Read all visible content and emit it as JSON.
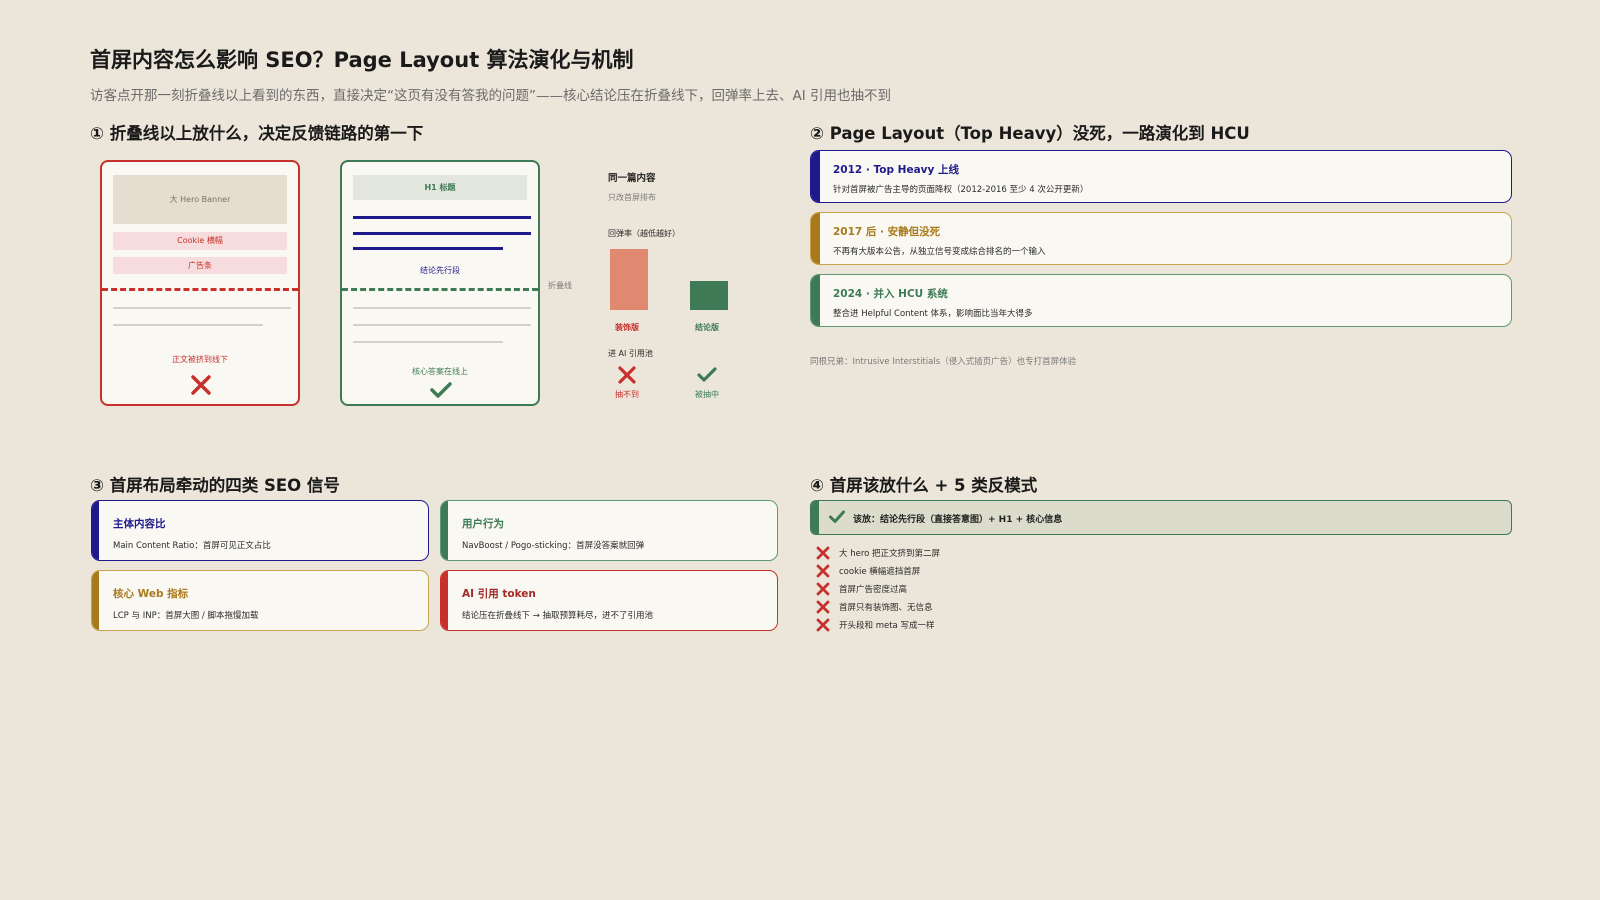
{
  "header": {
    "title": "首屏内容怎么影响 SEO？Page Layout 算法演化与机制",
    "subtitle": "访客点开那一刻折叠线以上看到的东西，直接决定“这页有没有答我的问题”——核心结论压在折叠线下，回弹率上去、AI 引用也抽不到"
  },
  "section1": {
    "title": "① 折叠线以上放什么，决定反馈链路的第一下",
    "bad_mock": {
      "hero": "大 Hero Banner",
      "cookie": "Cookie 横幅",
      "ad": "广告条",
      "caption": "正文被挤到线下"
    },
    "good_mock": {
      "h1": "H1 标题",
      "conclusion": "结论先行段",
      "caption": "核心答案在线上"
    },
    "fold_label": "折叠线",
    "compare": {
      "title": "同一篇内容",
      "subtitle": "只改首屏排布",
      "bounce_label": "回弹率（越低越好）",
      "decor_label": "装饰版",
      "concl_label": "结论版",
      "ai_label": "进 AI 引用池",
      "decor_ai": "抽不到",
      "concl_ai": "被抽中"
    }
  },
  "section2": {
    "title": "② Page Layout（Top Heavy）没死，一路演化到 HCU",
    "cards": [
      {
        "head": "2012 · Top Heavy 上线",
        "desc": "针对首屏被广告主导的页面降权（2012-2016 至少 4 次公开更新）",
        "color": "#1f1a8c"
      },
      {
        "head": "2017 后 · 安静但没死",
        "desc": "不再有大版本公告，从独立信号变成综合排名的一个输入",
        "color": "#a87a1e"
      },
      {
        "head": "2024 · 并入 HCU 系统",
        "desc": "整合进 Helpful Content 体系，影响面比当年大得多",
        "color": "#3d7a55"
      }
    ],
    "note": "同根兄弟：Intrusive Interstitials（侵入式插页广告）也专打首屏体验"
  },
  "section3": {
    "title": "③ 首屏布局牵动的四类 SEO 信号",
    "cards": [
      {
        "head": "主体内容比",
        "desc": "Main Content Ratio：首屏可见正文占比",
        "color": "#1f1a8c"
      },
      {
        "head": "用户行为",
        "desc": "NavBoost / Pogo-sticking：首屏没答案就回弹",
        "color": "#3d7a55"
      },
      {
        "head": "核心 Web 指标",
        "desc": "LCP 与 INP：首屏大图 / 脚本拖慢加载",
        "color": "#a87a1e"
      },
      {
        "head": "AI 引用 token",
        "desc": "结论压在折叠线下 → 抽取预算耗尽，进不了引用池",
        "color": "#c8302c"
      }
    ]
  },
  "section4": {
    "title": "④ 首屏该放什么 + 5 类反模式",
    "good": "该放：结论先行段（直接答意图）+ H1 + 核心信息",
    "anti": [
      "大 hero 把正文挤到第二屏",
      "cookie 横幅遮挡首屏",
      "首屏广告密度过高",
      "首屏只有装饰图、无信息",
      "开头段和 meta 写成一样"
    ]
  },
  "chart_data": {
    "type": "bar",
    "title": "回弹率（越低越好）",
    "categories": [
      "装饰版",
      "结论版"
    ],
    "series": [
      {
        "values": [
          2.1,
          1.0
        ]
      }
    ],
    "note": "Relative bar heights only; no numeric axis shown",
    "colors": {
      "bad": "#e08870",
      "good": "#3d7a55"
    }
  },
  "colors": {
    "background": "#ebe6d9",
    "navy": "#1f1a8c",
    "green": "#3d7a55",
    "gold": "#a87a1e",
    "red": "#c8302c"
  }
}
